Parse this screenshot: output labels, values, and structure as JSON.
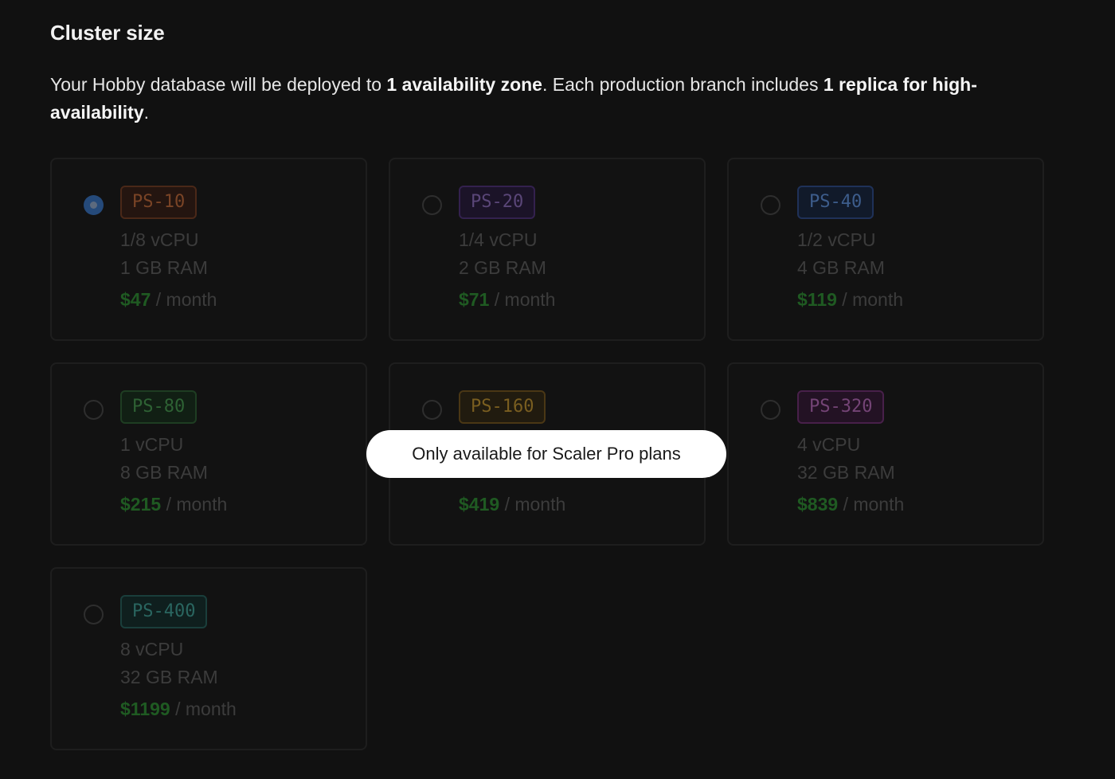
{
  "section": {
    "title": "Cluster size",
    "description": {
      "part1": "Your Hobby database will be deployed to ",
      "bold1": "1 availability zone",
      "part2": ". Each production branch includes ",
      "bold2": "1 replica for high-availability",
      "part3": "."
    }
  },
  "tooltip": {
    "text": "Only available for Scaler Pro plans"
  },
  "colors": {
    "price_green": "#1f5a22",
    "selected_radio": "#254a7a",
    "tooltip_bg": "#ffffff"
  },
  "plans": [
    {
      "name": "PS-10",
      "vcpu": "1/8 vCPU",
      "ram": "1 GB RAM",
      "price": "$47",
      "period": "/ month",
      "selected": true,
      "badge_colors": {
        "bg": "#241510",
        "border": "#4a2818",
        "text": "#7a4426"
      }
    },
    {
      "name": "PS-20",
      "vcpu": "1/4 vCPU",
      "ram": "2 GB RAM",
      "price": "$71",
      "period": "/ month",
      "selected": false,
      "badge_colors": {
        "bg": "#1b1328",
        "border": "#33214e",
        "text": "#5a4678"
      }
    },
    {
      "name": "PS-40",
      "vcpu": "1/2 vCPU",
      "ram": "4 GB RAM",
      "price": "$119",
      "period": "/ month",
      "selected": false,
      "badge_colors": {
        "bg": "#111a2a",
        "border": "#1f3158",
        "text": "#3d5d8c"
      }
    },
    {
      "name": "PS-80",
      "vcpu": "1 vCPU",
      "ram": "8 GB RAM",
      "price": "$215",
      "period": "/ month",
      "selected": false,
      "badge_colors": {
        "bg": "#111f14",
        "border": "#1e3d22",
        "text": "#2e6234"
      }
    },
    {
      "name": "PS-160",
      "vcpu": "",
      "ram": "",
      "price": "$419",
      "period": "/ month",
      "selected": false,
      "badge_colors": {
        "bg": "#211b0f",
        "border": "#4a3715",
        "text": "#7a5e20"
      }
    },
    {
      "name": "PS-320",
      "vcpu": "4 vCPU",
      "ram": "32 GB RAM",
      "price": "$839",
      "period": "/ month",
      "selected": false,
      "badge_colors": {
        "bg": "#231224",
        "border": "#48204a",
        "text": "#744476"
      }
    },
    {
      "name": "PS-400",
      "vcpu": "8 vCPU",
      "ram": "32 GB RAM",
      "price": "$1199",
      "period": "/ month",
      "selected": false,
      "badge_colors": {
        "bg": "#0f1f1e",
        "border": "#1a3e3b",
        "text": "#2a6660"
      }
    }
  ]
}
